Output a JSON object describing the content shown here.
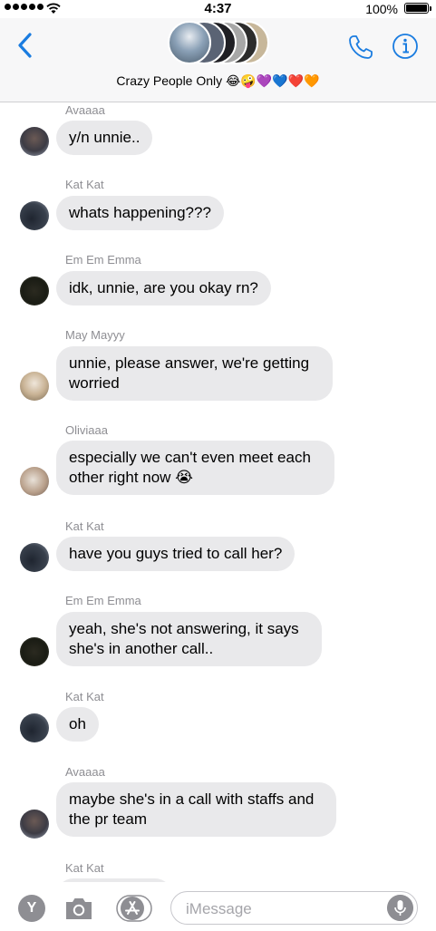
{
  "status_bar": {
    "time": "4:37",
    "battery": "100%"
  },
  "header": {
    "group_name": "Crazy People Only",
    "group_emojis": "😂🤪💜💙❤️🧡"
  },
  "messages": [
    {
      "sender": "Avaaaa",
      "avatar": "a",
      "text": "y/n unnie.."
    },
    {
      "sender": "Kat Kat",
      "avatar": "k",
      "text": "whats happening???"
    },
    {
      "sender": "Em Em Emma",
      "avatar": "e",
      "text": "idk, unnie, are you okay rn?"
    },
    {
      "sender": "May Mayyy",
      "avatar": "m",
      "text": "unnie, please answer, we're getting worried"
    },
    {
      "sender": "Oliviaaa",
      "avatar": "o",
      "text": "especially we can't even meet each other right now 😭"
    },
    {
      "sender": "Kat Kat",
      "avatar": "k",
      "text": "have you guys tried to call her?"
    },
    {
      "sender": "Em Em Emma",
      "avatar": "e",
      "text": "yeah, she's not answering, it says she's in another call.."
    },
    {
      "sender": "Kat Kat",
      "avatar": "k",
      "text": "oh"
    },
    {
      "sender": "Avaaaa",
      "avatar": "a",
      "text": "maybe she's in a call with staffs and the pr team"
    },
    {
      "sender": "Kat Kat",
      "avatar": "k",
      "text": ""
    }
  ],
  "composer": {
    "placeholder": "iMessage",
    "apps_letter": "Y"
  },
  "colors": {
    "accent": "#1a7ce0",
    "bubble": "#e9e9eb",
    "sender_gray": "#8e8e93"
  }
}
